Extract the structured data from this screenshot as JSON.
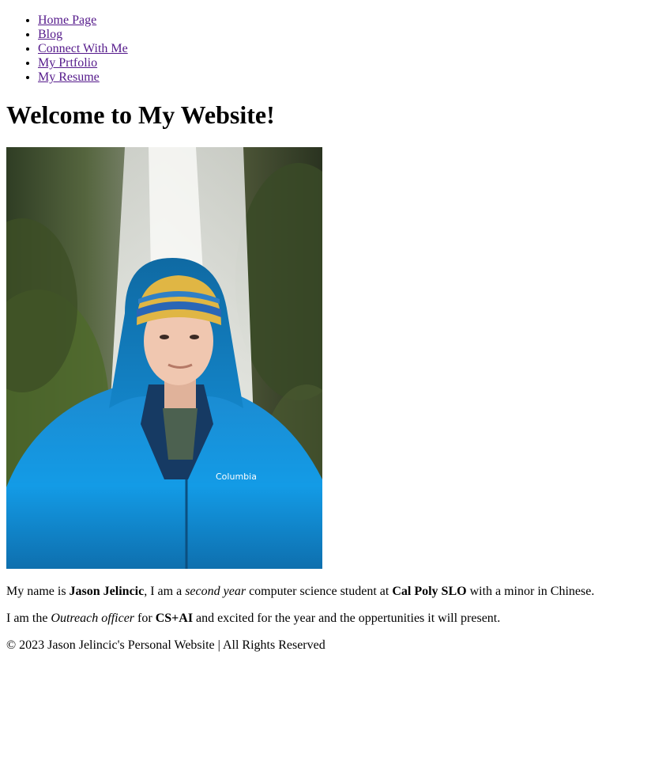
{
  "nav": {
    "items": [
      {
        "label": "Home Page"
      },
      {
        "label": "Blog"
      },
      {
        "label": "Connect With Me"
      },
      {
        "label": "My Prtfolio"
      },
      {
        "label": "My Resume"
      }
    ]
  },
  "main": {
    "title": "Welcome to My Website!",
    "photo_alt": "Person in blue Columbia jacket and beanie in front of a waterfall",
    "jacket_brand": "Columbia",
    "bio": {
      "p1_a": "My name is ",
      "p1_name": "Jason Jelincic",
      "p1_b": ", I am a ",
      "p1_year": "second year",
      "p1_c": " computer science student at ",
      "p1_school": "Cal Poly SLO",
      "p1_d": " with a minor in Chinese.",
      "p2_a": "I am the ",
      "p2_role": "Outreach officer",
      "p2_b": " for ",
      "p2_org": "CS+AI",
      "p2_c": " and excited for the year and the oppertunities it will present."
    }
  },
  "footer": {
    "text": "© 2023 Jason Jelincic's Personal Website | All Rights Reserved"
  },
  "colors": {
    "link": "#551a8b",
    "text": "#000000",
    "background": "#ffffff",
    "jacket": "#1a8fd8"
  }
}
